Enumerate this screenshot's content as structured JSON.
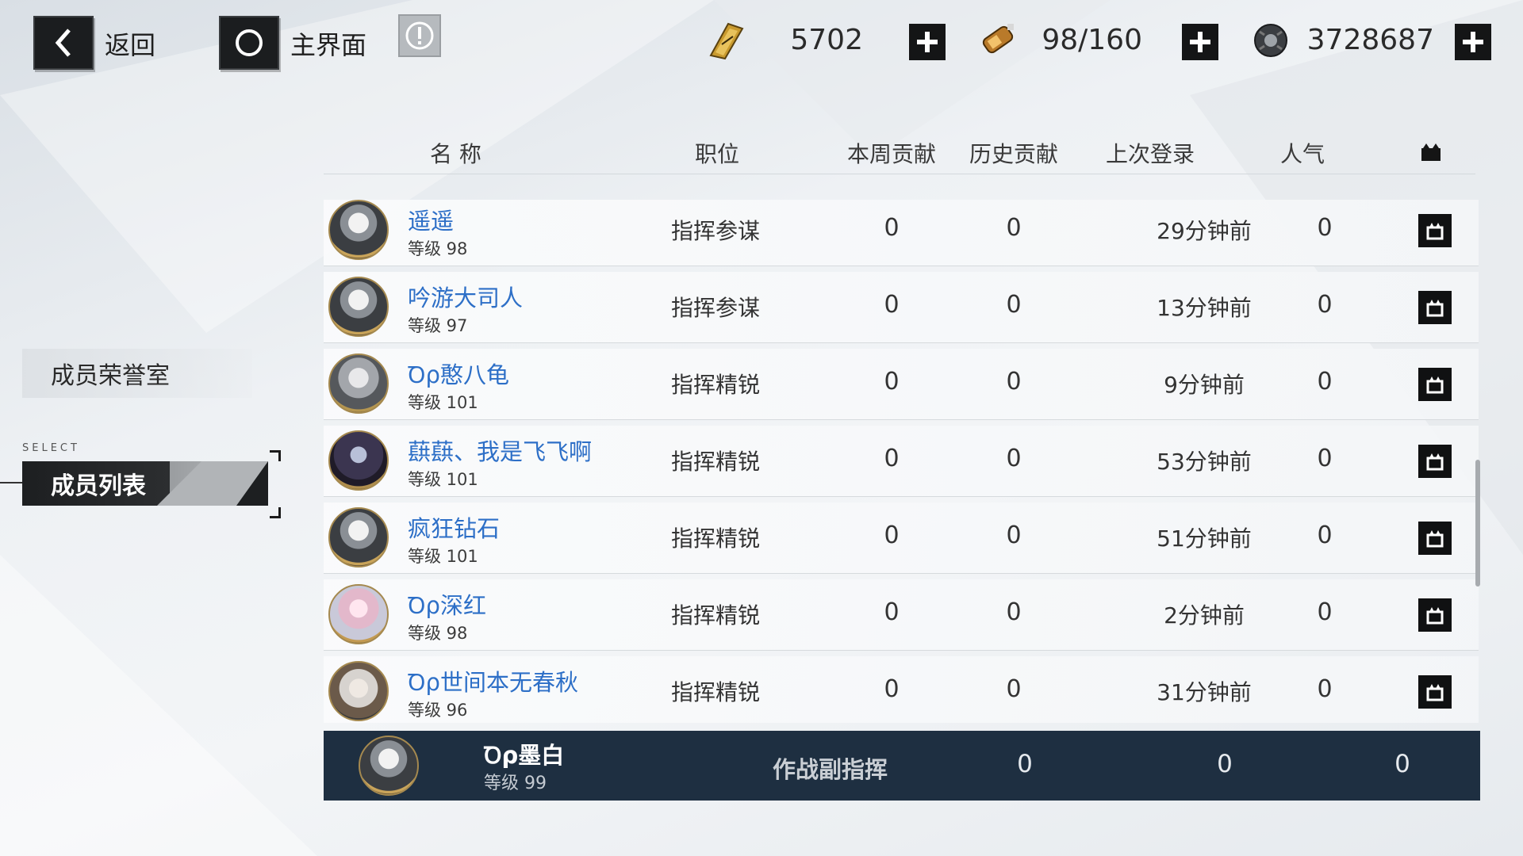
{
  "topbar": {
    "back_label": "返回",
    "home_label": "主界面",
    "resources": [
      {
        "icon": "ticket-icon",
        "value": "5702"
      },
      {
        "icon": "battery-icon",
        "value": "98/160"
      },
      {
        "icon": "gear-parts-icon",
        "value": "3728687"
      }
    ]
  },
  "sidebar": {
    "items": [
      {
        "label": "成员荣誉室",
        "selected": false
      },
      {
        "label": "成员列表",
        "selected": true
      }
    ],
    "select_tag": "SELECT"
  },
  "table": {
    "headers": {
      "name": "名 称",
      "position": "职位",
      "week_contrib": "本周贡献",
      "total_contrib": "历史贡献",
      "last_login": "上次登录",
      "popularity": "人气"
    },
    "rows": [
      {
        "name": "遥遥",
        "level": "等级 98",
        "position": "指挥参谋",
        "week": "0",
        "total": "0",
        "last": "29分钟前",
        "pop": "0"
      },
      {
        "name": "吟游大司人",
        "level": "等级 97",
        "position": "指挥参谋",
        "week": "0",
        "total": "0",
        "last": "13分钟前",
        "pop": "0"
      },
      {
        "name": "Ꝺρ憨八龟",
        "level": "等级 101",
        "position": "指挥精锐",
        "week": "0",
        "total": "0",
        "last": "9分钟前",
        "pop": "0"
      },
      {
        "name": "蕻蕻、我是飞飞啊",
        "level": "等级 101",
        "position": "指挥精锐",
        "week": "0",
        "total": "0",
        "last": "53分钟前",
        "pop": "0"
      },
      {
        "name": "疯狂钻石",
        "level": "等级 101",
        "position": "指挥精锐",
        "week": "0",
        "total": "0",
        "last": "51分钟前",
        "pop": "0"
      },
      {
        "name": "Ꝺρ深红",
        "level": "等级 98",
        "position": "指挥精锐",
        "week": "0",
        "total": "0",
        "last": "2分钟前",
        "pop": "0"
      },
      {
        "name": "Ꝺρ世间本无春秋",
        "level": "等级 96",
        "position": "指挥精锐",
        "week": "0",
        "total": "0",
        "last": "31分钟前",
        "pop": "0"
      }
    ]
  },
  "self": {
    "name": "Ꝺρ墨白",
    "level": "等级 99",
    "position": "作战副指挥",
    "week": "0",
    "total": "0",
    "pop": "0"
  }
}
